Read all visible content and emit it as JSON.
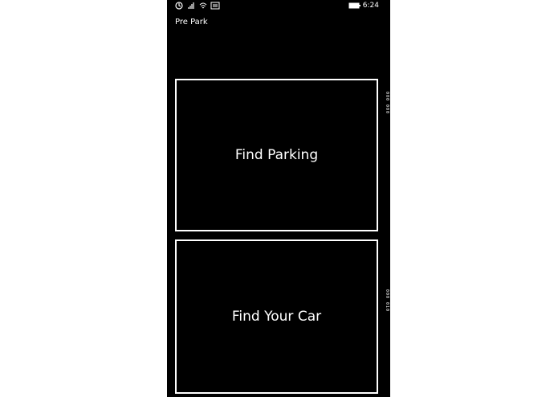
{
  "status_bar": {
    "time": "6:24",
    "icons": [
      "sync-icon",
      "signal-icon",
      "wifi-icon",
      "message-icon",
      "battery-icon"
    ]
  },
  "app": {
    "title": "Pre Park"
  },
  "tiles": {
    "find_parking": "Find Parking",
    "find_your_car": "Find Your Car"
  },
  "edge_labels": {
    "top": "000 000",
    "bottom": "000 010"
  }
}
